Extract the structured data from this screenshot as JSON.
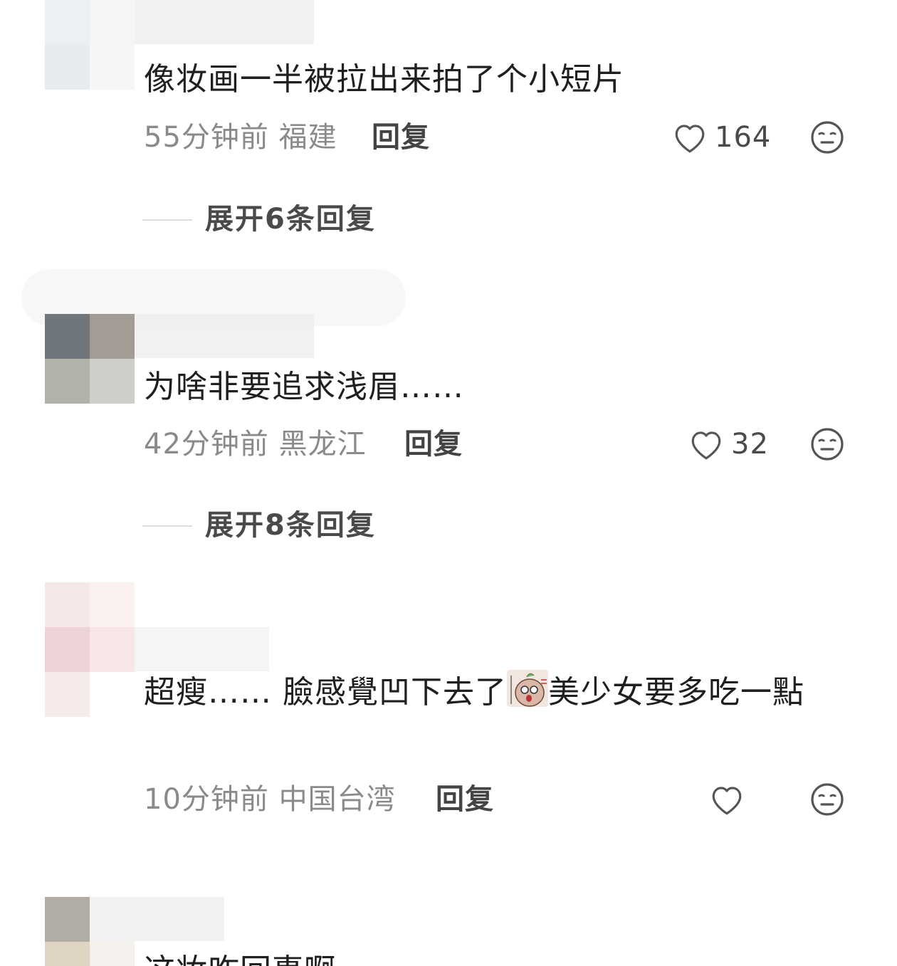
{
  "comments": [
    {
      "text": "像妆画一半被拉出来拍了个小短片",
      "time": "55分钟前",
      "location": "福建",
      "reply_label": "回复",
      "likes": "164",
      "expand": "展开6条回复"
    },
    {
      "text": "为啥非要追求浅眉……",
      "time": "42分钟前",
      "location": "黑龙江",
      "reply_label": "回复",
      "likes": "32",
      "expand": "展开8条回复"
    },
    {
      "text_before": "超瘦…… 臉感覺凹下去了",
      "text_after": "美少女要多吃一點",
      "time": "10分钟前",
      "location": "中国台湾",
      "reply_label": "回复",
      "likes": ""
    },
    {
      "text": "这妆咋回事啊"
    }
  ],
  "icons": {
    "like": "heart-outline-icon",
    "dislike": "meh-face-icon",
    "sticker": "emoji-sticker"
  },
  "colors": {
    "text": "#1f1f1f",
    "meta": "#8a8a8a",
    "icon": "#555555",
    "divider": "#dddddd"
  }
}
